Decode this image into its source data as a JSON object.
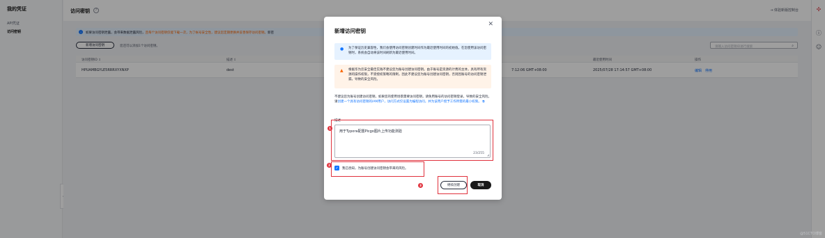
{
  "sidebar": {
    "title": "我的凭证",
    "items": [
      {
        "label": "API凭证"
      },
      {
        "label": "访问密钥"
      }
    ]
  },
  "header": {
    "title": "访问密钥",
    "feedback": "体验新版控制台"
  },
  "banner": {
    "text_normal": "如果访问密钥泄露，会带来数据泄露风险，",
    "text_warn": "且每个访问密钥仅能下载一次，为了帐号安全性，建议您定期更换并妥善保存访问密钥。",
    "text_tail": "新密"
  },
  "toolbar": {
    "create_label": "新增访问密钥",
    "quota_text": "您还可以添加1个访问密钥。",
    "search_placeholder": "请输入访问密钥ID进行搜索"
  },
  "table": {
    "columns": [
      "访问密钥ID ⇳",
      "描述 ⇳",
      "",
      "最近使用时间",
      "操作"
    ],
    "rows": [
      {
        "id": "HPUAMBGYLE5RRRXYXNXP",
        "desc": "dest",
        "created": "7:12:06 GMT+08:00",
        "last_used": "2025/07/28 17:14:57 GMT+08:00",
        "action_edit": "编辑",
        "action_disable": "停用"
      }
    ]
  },
  "modal": {
    "title": "新增访问密钥",
    "info_text": "为了保证历史兼容性，我们会使用访问密钥创建时间作为最近使用时间的初始值。在您使用该访问密钥时，系统会自动将该时间刷新为最近使用时间。",
    "warn_text": "根据华为云安全最佳实践不建议您为账号创建访问密钥。由于账号是资源的计费的主体，具有所有资源的操作权限，不受授权策略的限制，因此不建议您为账号创建访问密钥，否则因账号的访问密钥泄漏，导致的安全风险。",
    "advice_text": "不建议您为账号创建访问密钥，如果您的使用场景需要访问密钥，请免用账号的访问密钥登录，导致的安全风险。请",
    "advice_link": "创建一个具有访问密钥的IAM用户，访问方式仅设置为编程访问，并为该用户授予工作所需的最小权限。",
    "desc_label": "描述",
    "desc_value": "用于Typora配置Picgo图片上传功能测验",
    "char_count": "23/255",
    "ack_label": "我已悉知，为账号创建访问密钥会带来的风险。",
    "continue_label": "继续创建",
    "cancel_label": "取消"
  },
  "annotations": {
    "step1": "1",
    "step2": "2",
    "step3": "3"
  },
  "watermark": "@51CTO博客"
}
